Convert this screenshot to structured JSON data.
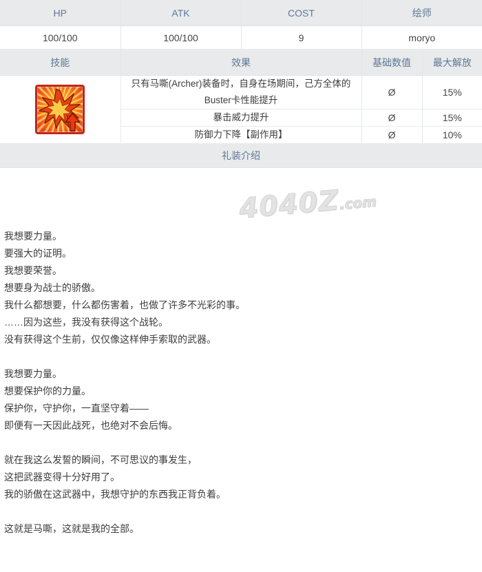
{
  "stats_table": {
    "headers": [
      "HP",
      "ATK",
      "COST",
      "绘师"
    ],
    "values": [
      "100/100",
      "100/100",
      "9",
      "moryo"
    ]
  },
  "skill_table": {
    "headers": [
      "技能",
      "效果",
      "基础数值",
      "最大解放"
    ],
    "icon": {
      "name": "buster-up-burst-icon",
      "border_color": "#c0261b",
      "accent_color": "#ff9c12"
    },
    "rows": [
      {
        "effect": "只有马嘶(Archer)装备时，自身在场期间，己方全体的Buster卡性能提升",
        "base": "Ø",
        "max": "15%"
      },
      {
        "effect": "暴击威力提升",
        "base": "Ø",
        "max": "15%"
      },
      {
        "effect": "防御力下降【副作用】",
        "base": "Ø",
        "max": "10%"
      }
    ]
  },
  "intro": {
    "title": "礼装介绍",
    "watermark_main": "4040",
    "watermark_z": "Z",
    "watermark_domain": ".com",
    "body": "我想要力量。\n要强大的证明。\n我想要荣誉。\n想要身为战士的骄傲。\n我什么都想要，什么都伤害着，也做了许多不光彩的事。\n……因为这些，我没有获得这个战轮。\n没有获得这个生前，仅仅像这样伸手索取的武器。\n\n我想要力量。\n想要保护你的力量。\n保护你，守护你，一直坚守着——\n即便有一天因此战死，也绝对不会后悔。\n\n就在我这么发誓的瞬间，不可思议的事发生，\n这把武器变得十分好用了。\n我的骄傲在这武器中，我想守护的东西我正背负着。\n\n这就是马嘶，这就是我的全部。"
  },
  "colors": {
    "header_bg": "#e8eaec",
    "header_text": "#5e7894",
    "body_text": "#3c3c3c",
    "border": "#e8eaec"
  }
}
